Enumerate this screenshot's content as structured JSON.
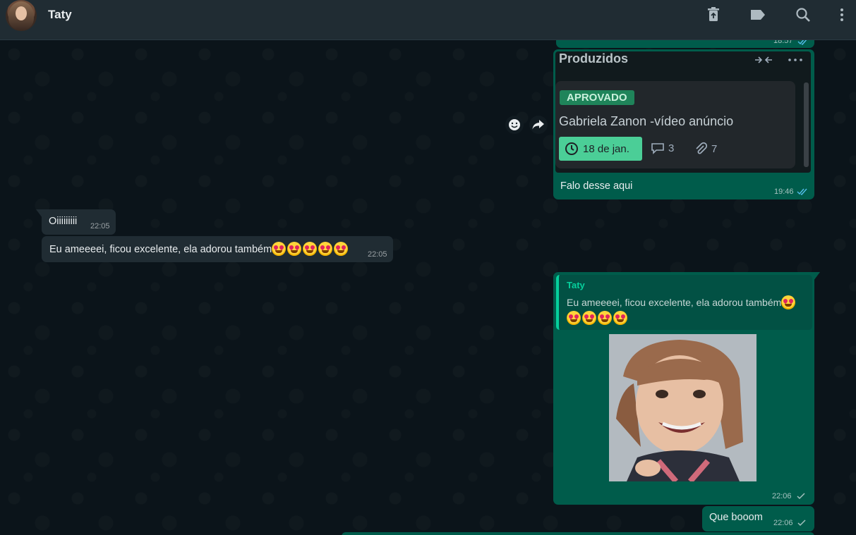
{
  "header": {
    "contact_name": "Taty"
  },
  "messages": {
    "top_partial": {
      "time": "18:57"
    },
    "card_message": {
      "card_title": "Produzidos",
      "badge": "APROVADO",
      "card_name": "Gabriela Zanon -vídeo anúncio",
      "date": "18 de jan.",
      "comments": "3",
      "attachments": "7",
      "text": "Falo desse aqui",
      "time": "19:46"
    },
    "incoming_1": {
      "text": "Oiiiiiiiii",
      "time": "22:05"
    },
    "incoming_2": {
      "text": "Eu ameeeei, ficou excelente, ela adorou também",
      "time": "22:05"
    },
    "reply_message": {
      "quote_author": "Taty",
      "quote_text": "Eu ameeeei, ficou excelente, ela adorou também",
      "time": "22:06"
    },
    "outgoing_last": {
      "text": "Que booom",
      "time": "22:06"
    }
  },
  "colors": {
    "outgoing_bubble": "#005c4b",
    "incoming_bubble": "#202c33",
    "header": "#202c33",
    "chat_background": "#0b141a",
    "accent": "#06cf9c",
    "read_tick": "#53bdeb"
  }
}
